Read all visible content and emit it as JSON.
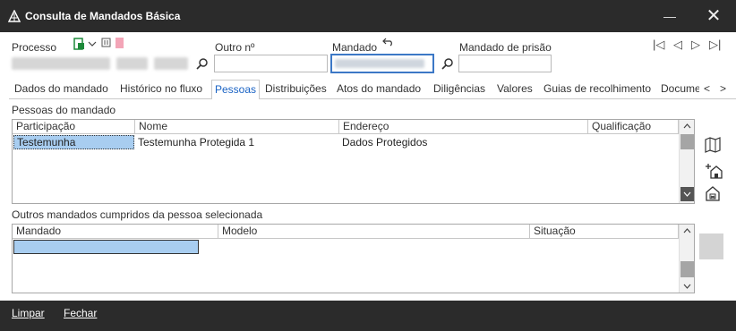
{
  "window": {
    "title": "Consulta de Mandados Básica",
    "minimize_glyph": "—",
    "close_glyph": "✕"
  },
  "header": {
    "processo_label": "Processo",
    "outro_label": "Outro nº",
    "mandado_label": "Mandado",
    "mandado_prisao_label": "Mandado de prisão",
    "outro_value": "",
    "mandado_prisao_value": "",
    "nav": {
      "first_glyph": "|◁",
      "prev_glyph": "◁",
      "next_glyph": "▷",
      "last_glyph": "▷|"
    }
  },
  "tabs": [
    {
      "label": "Dados do mandado"
    },
    {
      "label": "Histórico no fluxo"
    },
    {
      "label": "Pessoas"
    },
    {
      "label": "Distribuições"
    },
    {
      "label": "Atos do mandado"
    },
    {
      "label": "Diligências"
    },
    {
      "label": "Valores"
    },
    {
      "label": "Guias de recolhimento"
    },
    {
      "label": "Docume"
    }
  ],
  "tab_scroll": {
    "left": "<",
    "right": ">"
  },
  "pessoas": {
    "section_label": "Pessoas do mandado",
    "columns": [
      "Participação",
      "Nome",
      "Endereço",
      "Qualificação"
    ],
    "rows": [
      {
        "participacao": "Testemunha",
        "nome": "Testemunha Protegida 1",
        "endereco": "Dados Protegidos",
        "qualificacao": ""
      }
    ]
  },
  "outros": {
    "section_label": "Outros mandados cumpridos da pessoa selecionada",
    "columns": [
      "Mandado",
      "Modelo",
      "Situação"
    ]
  },
  "bottom": {
    "limpar": "Limpar",
    "fechar": "Fechar"
  },
  "colors": {
    "titlebar": "#2b2b2b",
    "accent": "#1a63c4",
    "selection": "#a8cdf0",
    "focus_border": "#3c78c6"
  },
  "icons": [
    "app-logo-icon",
    "new-document-icon",
    "chevron-down-icon",
    "note-icon",
    "marker-icon",
    "undo-arrow-icon",
    "search-icon",
    "people-map-icon",
    "add-house-icon",
    "locked-house-icon"
  ]
}
